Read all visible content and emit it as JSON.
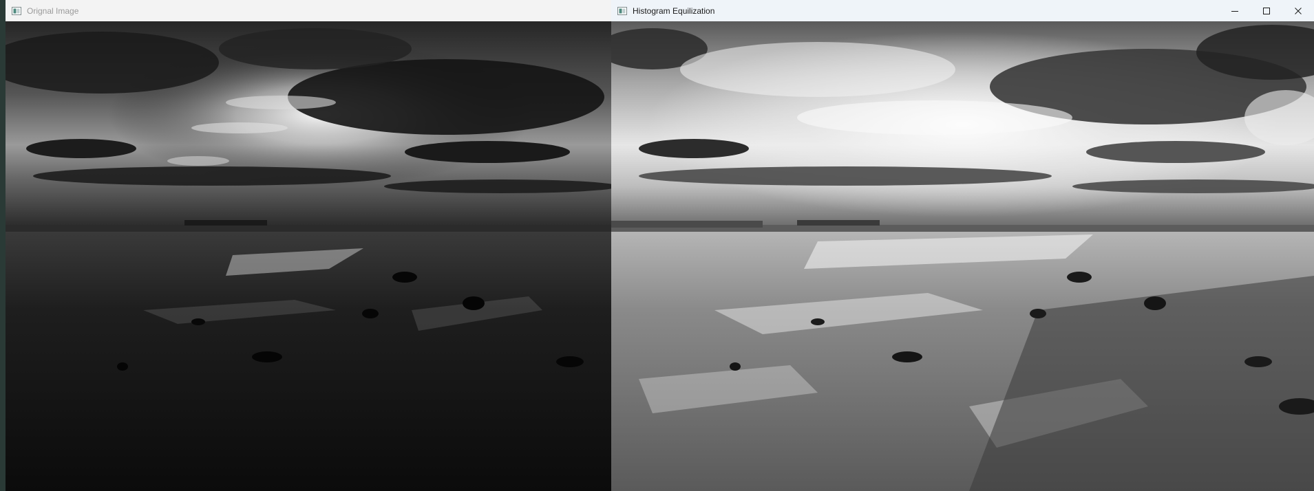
{
  "windows": {
    "original": {
      "title": "Orignal Image",
      "state": "inactive",
      "icon": "image-window-icon",
      "tone": "dark"
    },
    "equalized": {
      "title": "Histogram Equilization",
      "state": "active",
      "icon": "image-window-icon",
      "tone": "bright",
      "buttons": [
        {
          "name": "minimize-button",
          "icon": "minimize-icon"
        },
        {
          "name": "maximize-button",
          "icon": "maximize-icon"
        },
        {
          "name": "close-button",
          "icon": "close-icon"
        }
      ]
    }
  },
  "colors": {
    "titlebar_active": "#eff4f9",
    "titlebar_inactive": "#f3f3f3",
    "desktop": "#24302e"
  }
}
